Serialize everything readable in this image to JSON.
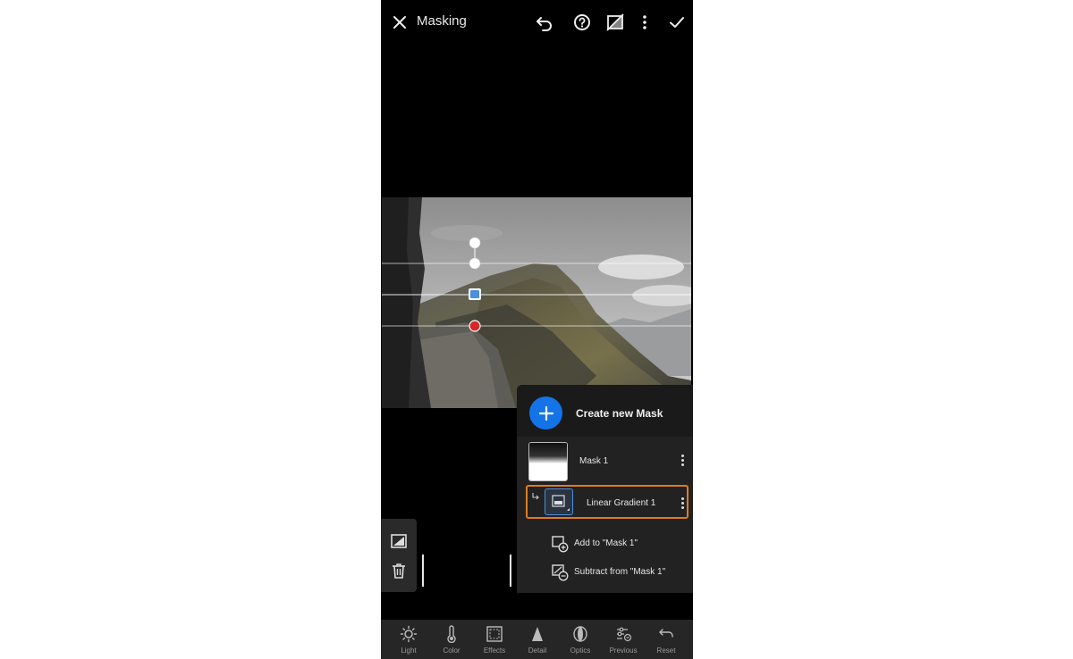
{
  "header": {
    "title": "Masking",
    "icons": [
      "close-icon",
      "undo-icon",
      "help-icon",
      "mask-overlay-icon",
      "more-icon",
      "checkmark-icon"
    ]
  },
  "mask_panel": {
    "create_label": "Create new Mask",
    "masks": [
      {
        "name": "Mask 1"
      }
    ],
    "components": [
      {
        "name": "Linear Gradient 1",
        "selected": true
      }
    ],
    "actions": [
      {
        "label": "Add to \"Mask 1\"",
        "icon": "add-mask-icon"
      },
      {
        "label": "Subtract from \"Mask 1\"",
        "icon": "subtract-mask-icon"
      }
    ]
  },
  "side_tools": [
    "invert-mask-icon",
    "trash-icon"
  ],
  "toolbar": {
    "items": [
      {
        "label": "Light",
        "icon": "light-icon"
      },
      {
        "label": "Color",
        "icon": "color-icon"
      },
      {
        "label": "Effects",
        "icon": "effects-icon"
      },
      {
        "label": "Detail",
        "icon": "detail-icon"
      },
      {
        "label": "Optics",
        "icon": "optics-icon"
      },
      {
        "label": "Previous",
        "icon": "previous-icon"
      },
      {
        "label": "Reset",
        "icon": "reset-icon"
      }
    ]
  },
  "colors": {
    "accent": "#1473e6",
    "selection_border": "#e07b1f",
    "gradient_pin": "#d62828"
  }
}
